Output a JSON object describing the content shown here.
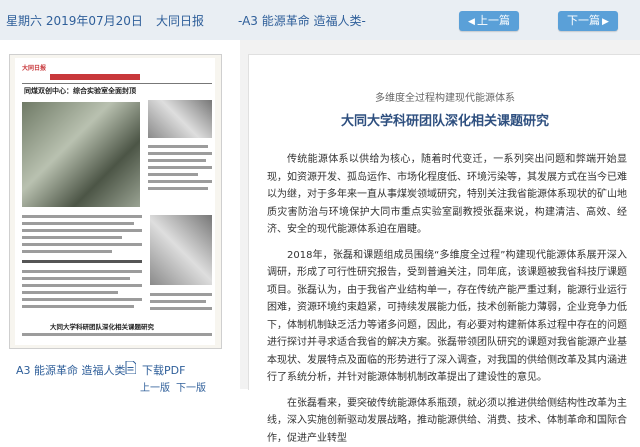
{
  "header": {
    "date": "星期六 2019年07月20日",
    "paper": "大同日报",
    "section": "-A3 能源革命 造福人类-",
    "prev_label": "上一篇",
    "next_label": "下一篇"
  },
  "page_thumb": {
    "masthead": "大同日报",
    "headline_1": "同煤双创中心：综合实验室全面封顶",
    "headline_2": "大同大学科研团队深化相关课题研究"
  },
  "page_nav": {
    "page_label": "A3 能源革命 造福人类",
    "download_label": "下载PDF",
    "prev_page": "上一版",
    "next_page": "下一版"
  },
  "article": {
    "subtitle": "多维度全过程构建现代能源体系",
    "title": "大同大学科研团队深化相关课题研究",
    "paragraphs": [
      "传统能源体系以供给为核心，随着时代变迁，一系列突出问题和弊端开始显现，如资源开发、孤岛运作、市场化程度低、环境污染等，其发展方式在当今已难以为继，对于多年来一直从事煤炭领域研究，特别关注我省能源体系现状的矿山地质灾害防治与环境保护大同市重点实验室副教授张磊来说，构建清洁、高效、经济、安全的现代能源体系迫在眉睫。",
      "2018年，张磊和课题组成员围绕“多维度全过程”构建现代能源体系展开深入调研，形成了可行性研究报告，受到普遍关注，同年底，该课题被我省科技厅课题项目。张磊认为，由于我省产业结构单一，存在传统产能严重过剩，能源行业运行困难，资源环境约束趋紧，可持续发展能力低，技术创新能力薄弱，企业竞争力低下，体制机制缺乏活力等诸多问题，因此，有必要对构建新体系过程中存在的问题进行探讨并寻求适合我省的解决方案。张磊带领团队研究的课题对我省能源产业基本现状、发展特点及面临的形势进行了深入调查，对我国的供给侧改革及其内涵进行了系统分析，并针对能源体制机制改革提出了建设性的意见。",
      "在张磊看来，要突破传统能源体系瓶颈，就必须以推进供给侧结构性改革为主线，深入实施创新驱动发展战略，推动能源供给、消费、技术、体制革命和国际合作，促进产业转型"
    ]
  },
  "colors": {
    "header_bg": "#e9eef3",
    "link_blue": "#2f5f9a",
    "button_blue": "#5aa0d8",
    "title_blue": "#2e4f7f",
    "panel_gray": "#f2f2f2"
  }
}
